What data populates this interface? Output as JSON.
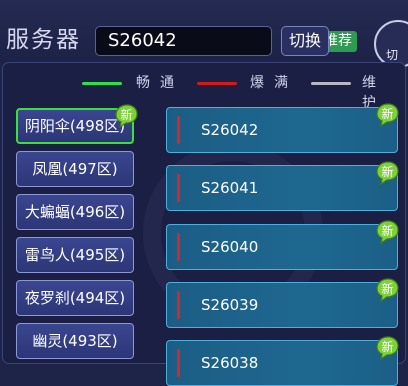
{
  "header": {
    "title": "服务器",
    "search_value": "S26042",
    "recommend_label": "推荐",
    "switch_label": "切换",
    "corner_label": "切"
  },
  "legend": [
    {
      "label": "畅通",
      "color": "#2ee04a"
    },
    {
      "label": "爆满",
      "color": "#d61a1a"
    },
    {
      "label": "维护",
      "color": "#b8b8c4"
    }
  ],
  "badge_text": "新",
  "categories": [
    {
      "label": "阴阳伞(498区)",
      "active": true
    },
    {
      "label": "凤凰(497区)",
      "active": false
    },
    {
      "label": "大蝙蝠(496区)",
      "active": false
    },
    {
      "label": "雷鸟人(495区)",
      "active": false
    },
    {
      "label": "夜罗刹(494区)",
      "active": false
    },
    {
      "label": "幽灵(493区)",
      "active": false
    }
  ],
  "servers": [
    {
      "name": "S26042",
      "status": "爆满"
    },
    {
      "name": "S26041",
      "status": "爆满"
    },
    {
      "name": "S26040",
      "status": "爆满"
    },
    {
      "name": "S26039",
      "status": "爆满"
    },
    {
      "name": "S26038",
      "status": "爆满"
    }
  ]
}
